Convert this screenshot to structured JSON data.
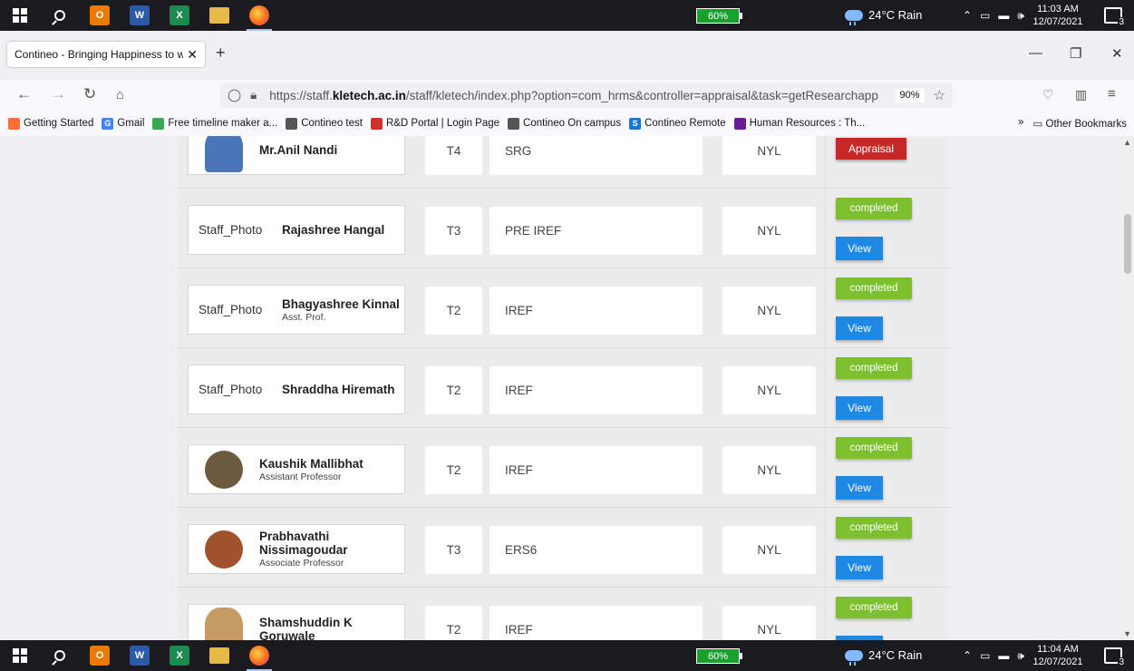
{
  "taskbar_top": {
    "battery": "60%",
    "weather": "24°C Rain",
    "time": "11:03 AM",
    "date": "12/07/2021",
    "notifications": "3"
  },
  "taskbar_bottom": {
    "battery": "60%",
    "weather": "24°C Rain",
    "time": "11:04 AM",
    "date": "12/07/2021",
    "notifications": "3"
  },
  "browser": {
    "tab_title": "Contineo - Bringing Happiness to w",
    "new_tab": "+",
    "url_prefix": "https://staff.",
    "url_domain": "kletech.ac.in",
    "url_rest": "/staff/kletech/index.php?option=com_hrms&controller=appraisal&task=getResearchapp",
    "zoom": "90%",
    "bookmarks": [
      {
        "label": "Getting Started",
        "color": "#ff7139",
        "glyph": ""
      },
      {
        "label": "Gmail",
        "color": "#4285f4",
        "glyph": "G"
      },
      {
        "label": "Free timeline maker a...",
        "color": "#3aa757",
        "glyph": ""
      },
      {
        "label": "Contineo test",
        "color": "#555555",
        "glyph": ""
      },
      {
        "label": "R&D Portal | Login Page",
        "color": "#d32f2f",
        "glyph": ""
      },
      {
        "label": "Contineo On campus",
        "color": "#555555",
        "glyph": ""
      },
      {
        "label": "Contineo Remote",
        "color": "#1976d2",
        "glyph": "S"
      },
      {
        "label": "Human Resources : Th...",
        "color": "#6a1b9a",
        "glyph": ""
      }
    ],
    "other_bookmarks": "Other Bookmarks"
  },
  "staff_rows": [
    {
      "photo": "",
      "name": "Mr.Anil Nandi",
      "designation": "",
      "grade": "T4",
      "category": "SRG",
      "status": "NYL",
      "action": "Appraisal",
      "avatar_color": "#4a76b8"
    },
    {
      "photo": "Staff_Photo",
      "name": "Rajashree Hangal",
      "designation": "",
      "grade": "T3",
      "category": "PRE IREF",
      "status": "NYL",
      "badge": "completed",
      "action": "View"
    },
    {
      "photo": "Staff_Photo",
      "name": "Bhagyashree Kinnal",
      "designation": "Asst. Prof.",
      "grade": "T2",
      "category": "IREF",
      "status": "NYL",
      "badge": "completed",
      "action": "View"
    },
    {
      "photo": "Staff_Photo",
      "name": "Shraddha Hiremath",
      "designation": "",
      "grade": "T2",
      "category": "IREF",
      "status": "NYL",
      "badge": "completed",
      "action": "View"
    },
    {
      "photo": "",
      "name": "Kaushik Mallibhat",
      "designation": "Assistant Professor",
      "grade": "T2",
      "category": "IREF",
      "status": "NYL",
      "badge": "completed",
      "action": "View",
      "avatar_color": "#6b5a3e"
    },
    {
      "photo": "",
      "name": "Prabhavathi Nissimagoudar",
      "designation": "Associate Professor",
      "grade": "T3",
      "category": "ERS6",
      "status": "NYL",
      "badge": "completed",
      "action": "View",
      "avatar_color": "#a0522d"
    },
    {
      "photo": "",
      "name": "Shamshuddin K Goruwale",
      "designation": "",
      "grade": "T2",
      "category": "IREF",
      "status": "NYL",
      "badge": "completed",
      "action": "View",
      "avatar_color": "#c59a63"
    }
  ],
  "colors": {
    "completed": "#7cbf2f",
    "view": "#1e88e5",
    "appraisal": "#c62828"
  }
}
